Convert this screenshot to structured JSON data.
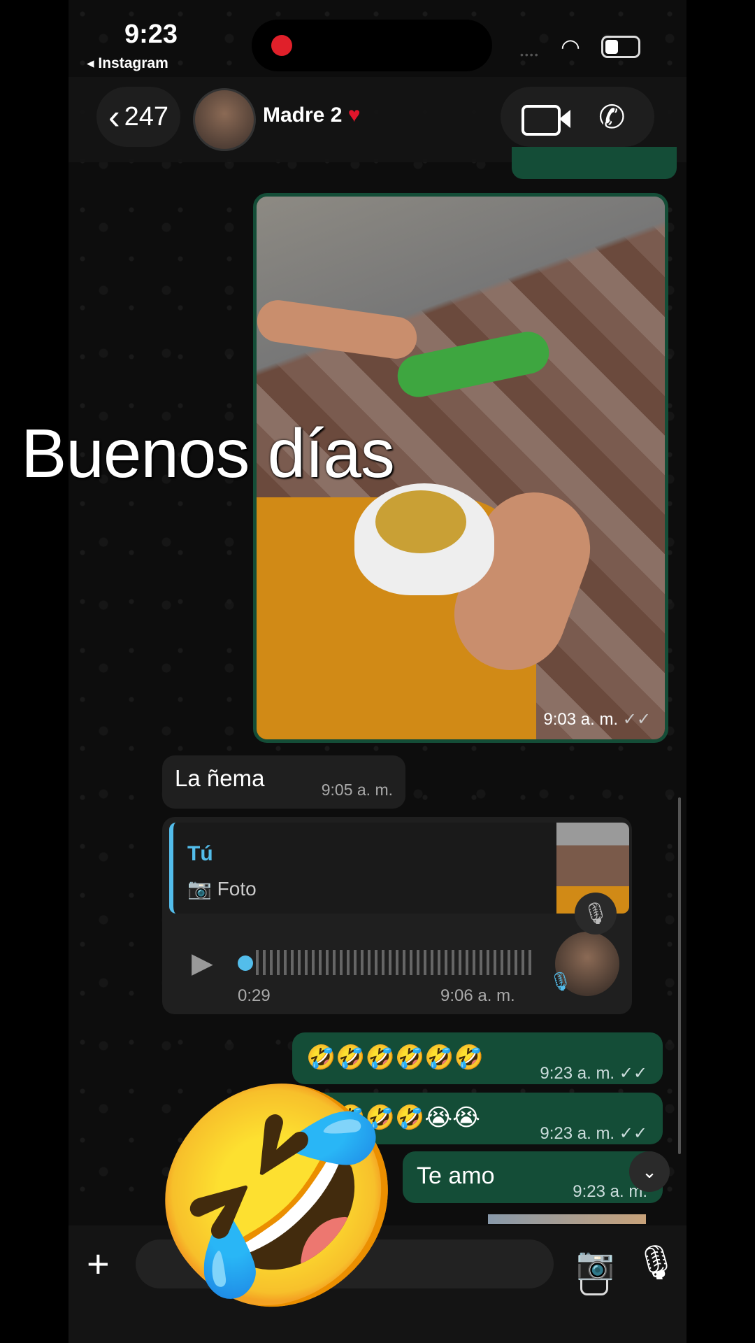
{
  "status": {
    "time": "9:23",
    "moon": "☾",
    "back_app": "◂ Instagram",
    "signal": "••••"
  },
  "header": {
    "back_count": "247",
    "back_chevron": "‹",
    "contact_name": "Madre 2",
    "heart": "♥"
  },
  "overlay_caption": "Buenos días",
  "messages": {
    "top_time": "9:03 a. m.",
    "photo_time": "9:03 a. m.",
    "photo_ticks": "✓✓",
    "nema_text": "La ñema",
    "nema_time": "9:05 a. m.",
    "reply_who": "Tú",
    "reply_what": "📷 Foto",
    "voice_duration": "0:29",
    "voice_time": "9:06 a. m.",
    "emoji_row1": "🤣🤣🤣🤣🤣🤣",
    "emoji_row1_time": "9:23 a. m.",
    "emoji_row2": "🤣🤣🤣🤣😭😭",
    "emoji_row2_time": "9:23 a. m.",
    "te_amo": "Te amo",
    "te_amo_time": "9:23 a. m.",
    "ticks": "✓✓"
  },
  "big_emoji": "🤣",
  "icons": {
    "play": "▶",
    "mic": "🎙",
    "chevron_down": "⌄",
    "plus": "+",
    "camera": "📷",
    "phone": "✆"
  }
}
